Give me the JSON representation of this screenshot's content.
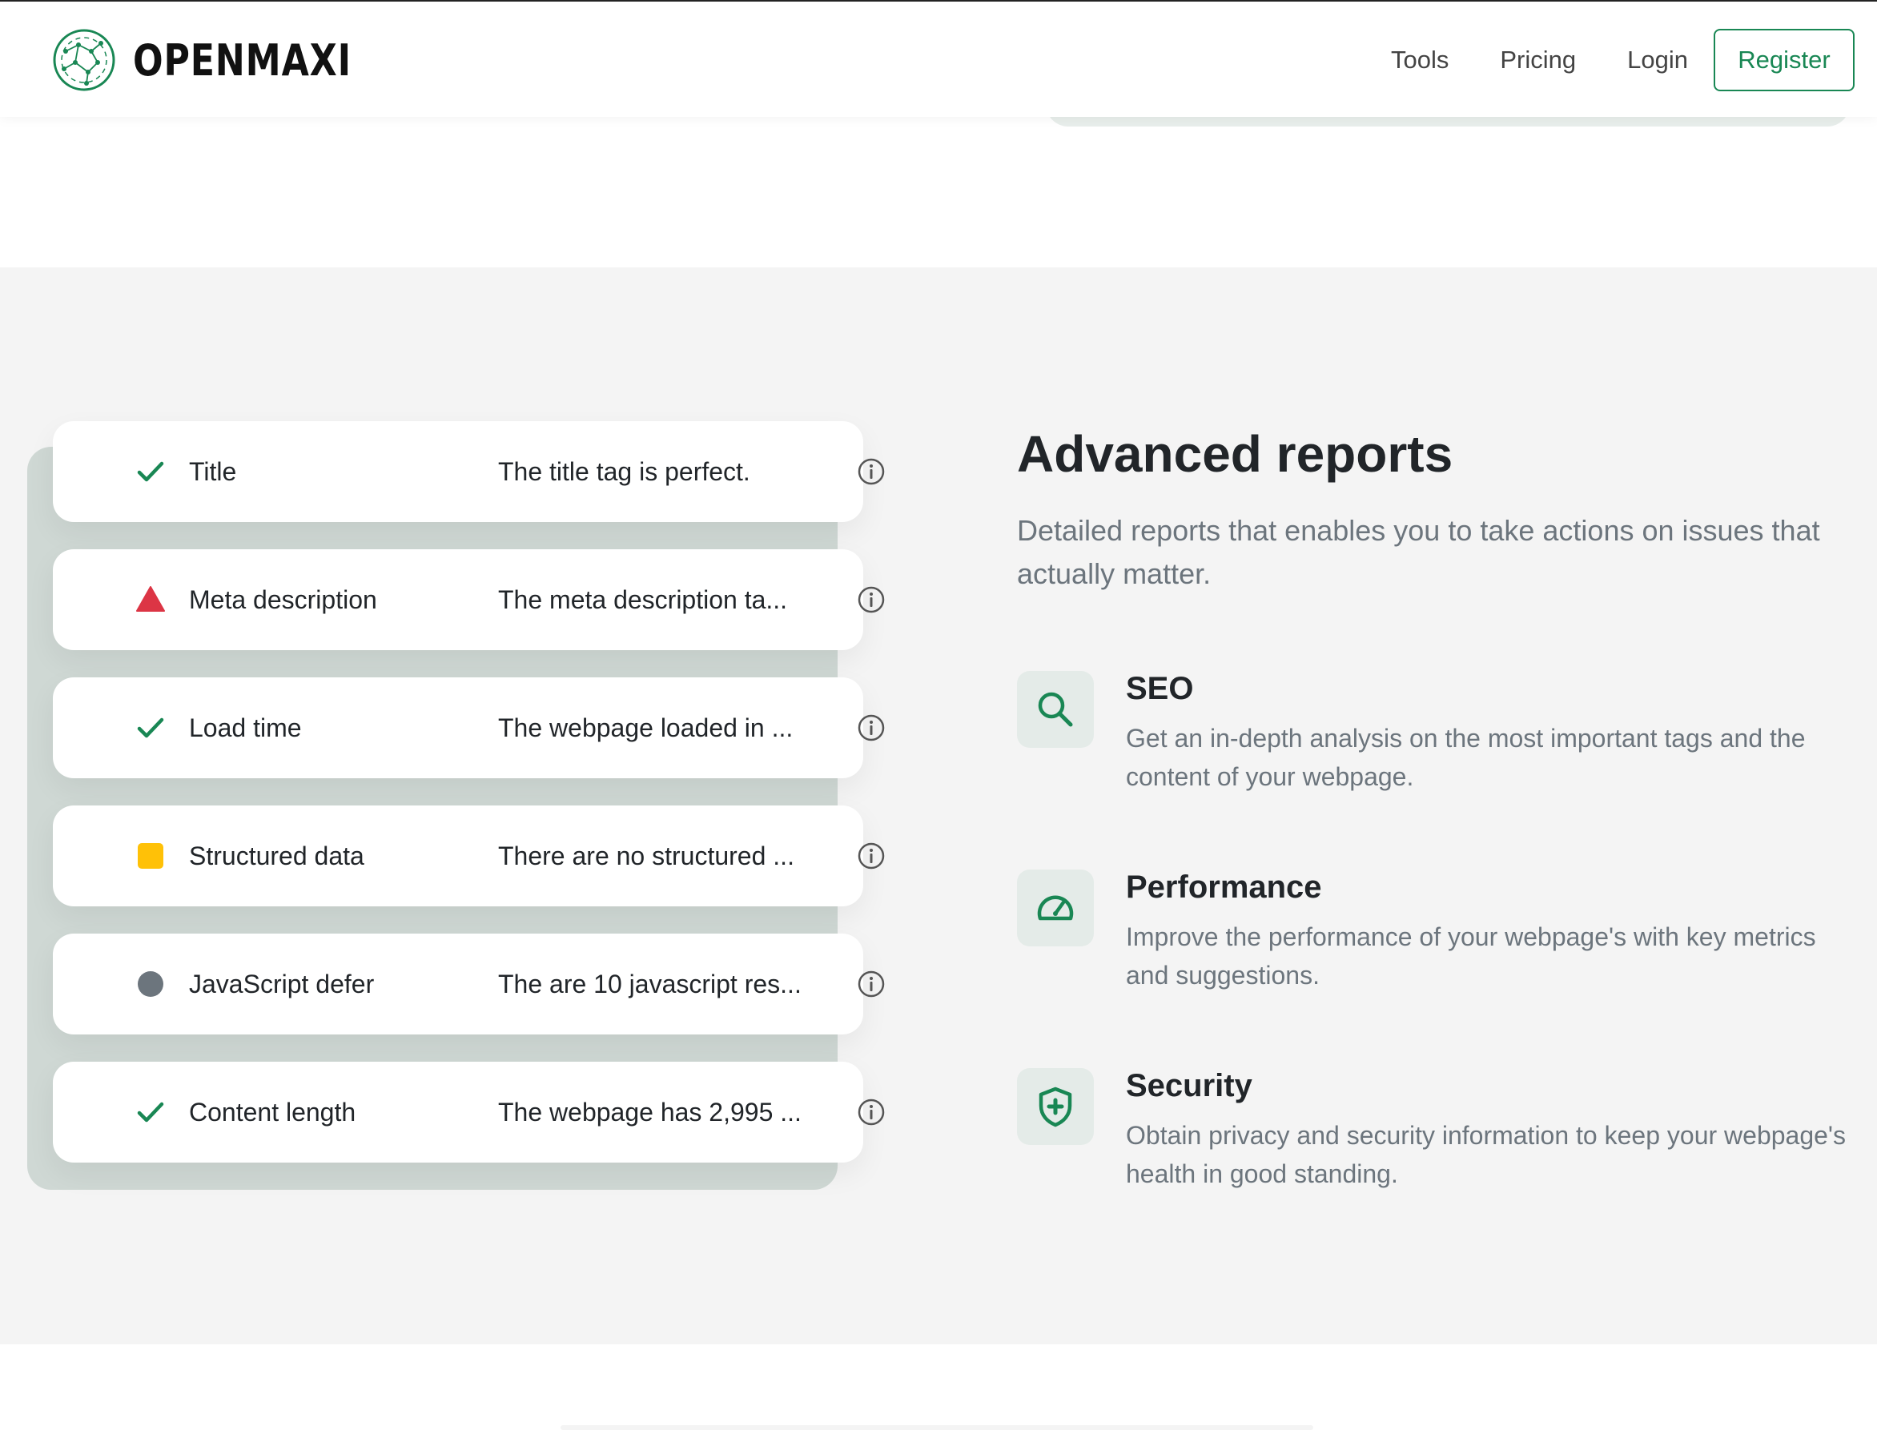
{
  "header": {
    "brand": "OPENMAXI",
    "nav": [
      {
        "label": "Tools"
      },
      {
        "label": "Pricing"
      },
      {
        "label": "Login"
      }
    ],
    "register_label": "Register"
  },
  "report_rows": [
    {
      "status": "passed",
      "icon": "check-icon",
      "label": "Title",
      "value": "The title tag is perfect."
    },
    {
      "status": "high",
      "icon": "triangle-warning-icon",
      "label": "Meta description",
      "value": "The meta description ta..."
    },
    {
      "status": "passed",
      "icon": "check-icon",
      "label": "Load time",
      "value": "The webpage loaded in ..."
    },
    {
      "status": "medium",
      "icon": "square-status-icon",
      "label": "Structured data",
      "value": "There are no structured ..."
    },
    {
      "status": "low",
      "icon": "circle-status-icon",
      "label": "JavaScript defer",
      "value": "The are 10 javascript res..."
    },
    {
      "status": "passed",
      "icon": "check-icon",
      "label": "Content length",
      "value": "The webpage has 2,995 ..."
    }
  ],
  "section": {
    "title": "Advanced reports",
    "lead": "Detailed reports that enables you to take actions on issues that actually matter.",
    "features": [
      {
        "icon": "search-icon",
        "title": "SEO",
        "text": "Get an in-depth analysis on the most important tags and the content of your webpage."
      },
      {
        "icon": "speedometer-icon",
        "title": "Performance",
        "text": "Improve the performance of your webpage's with key metrics and suggestions."
      },
      {
        "icon": "shield-plus-icon",
        "title": "Security",
        "text": "Obtain privacy and security information to keep your webpage's health in good standing."
      }
    ]
  },
  "colors": {
    "accent": "#198754",
    "danger": "#dc3545",
    "warning": "#ffc107",
    "neutral": "#6c757d"
  }
}
